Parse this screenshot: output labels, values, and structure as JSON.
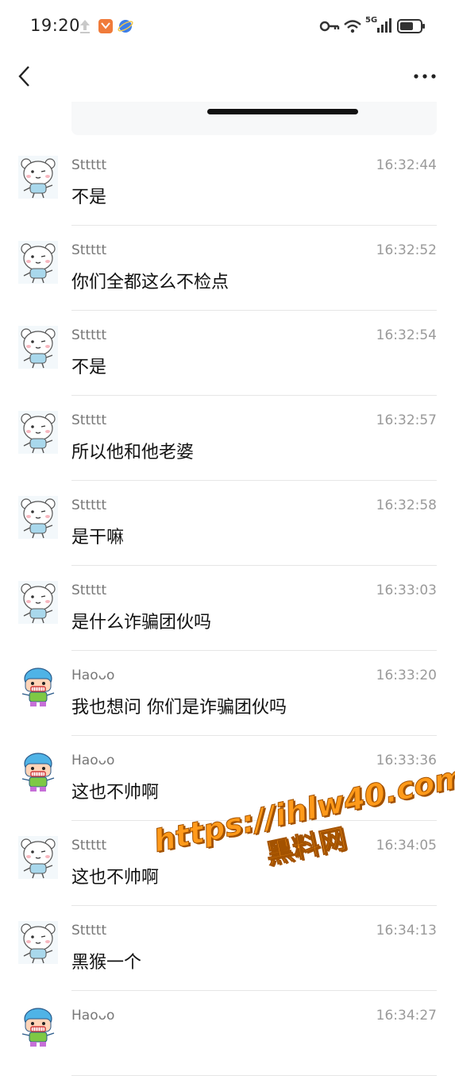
{
  "status_bar": {
    "time": "19:20",
    "network_label": "5G"
  },
  "colors": {
    "background": "#ffffff",
    "text_primary": "#111111",
    "text_secondary": "#777777",
    "timestamp": "#9a9a9a",
    "divider": "#e6e6e6",
    "watermark_fill": "#ff9a1a",
    "watermark_outline": "#a35200"
  },
  "watermark": {
    "url": "https://ihlw40.com",
    "label": "黑料网"
  },
  "messages": [
    {
      "sender": "Sttttt",
      "time": "16:32:44",
      "text": "不是",
      "avatar": "bear-avatar-icon"
    },
    {
      "sender": "Sttttt",
      "time": "16:32:52",
      "text": "你们全都这么不检点",
      "avatar": "bear-avatar-icon"
    },
    {
      "sender": "Sttttt",
      "time": "16:32:54",
      "text": "不是",
      "avatar": "bear-avatar-icon"
    },
    {
      "sender": "Sttttt",
      "time": "16:32:57",
      "text": "所以他和他老婆",
      "avatar": "bear-avatar-icon"
    },
    {
      "sender": "Sttttt",
      "time": "16:32:58",
      "text": "是干嘛",
      "avatar": "bear-avatar-icon"
    },
    {
      "sender": "Sttttt",
      "time": "16:33:03",
      "text": "是什么诈骗团伙吗",
      "avatar": "bear-avatar-icon"
    },
    {
      "sender": "Haoᴗo",
      "time": "16:33:20",
      "text": "我也想问 你们是诈骗团伙吗",
      "avatar": "cartoon-avatar-icon"
    },
    {
      "sender": "Haoᴗo",
      "time": "16:33:36",
      "text": "这也不帅啊",
      "avatar": "cartoon-avatar-icon"
    },
    {
      "sender": "Sttttt",
      "time": "16:34:05",
      "text": "这也不帅啊",
      "avatar": "bear-avatar-icon"
    },
    {
      "sender": "Sttttt",
      "time": "16:34:13",
      "text": "黑猴一个",
      "avatar": "bear-avatar-icon"
    },
    {
      "sender": "Haoᴗo",
      "time": "16:34:27",
      "text": "",
      "avatar": "cartoon-avatar-icon"
    }
  ]
}
